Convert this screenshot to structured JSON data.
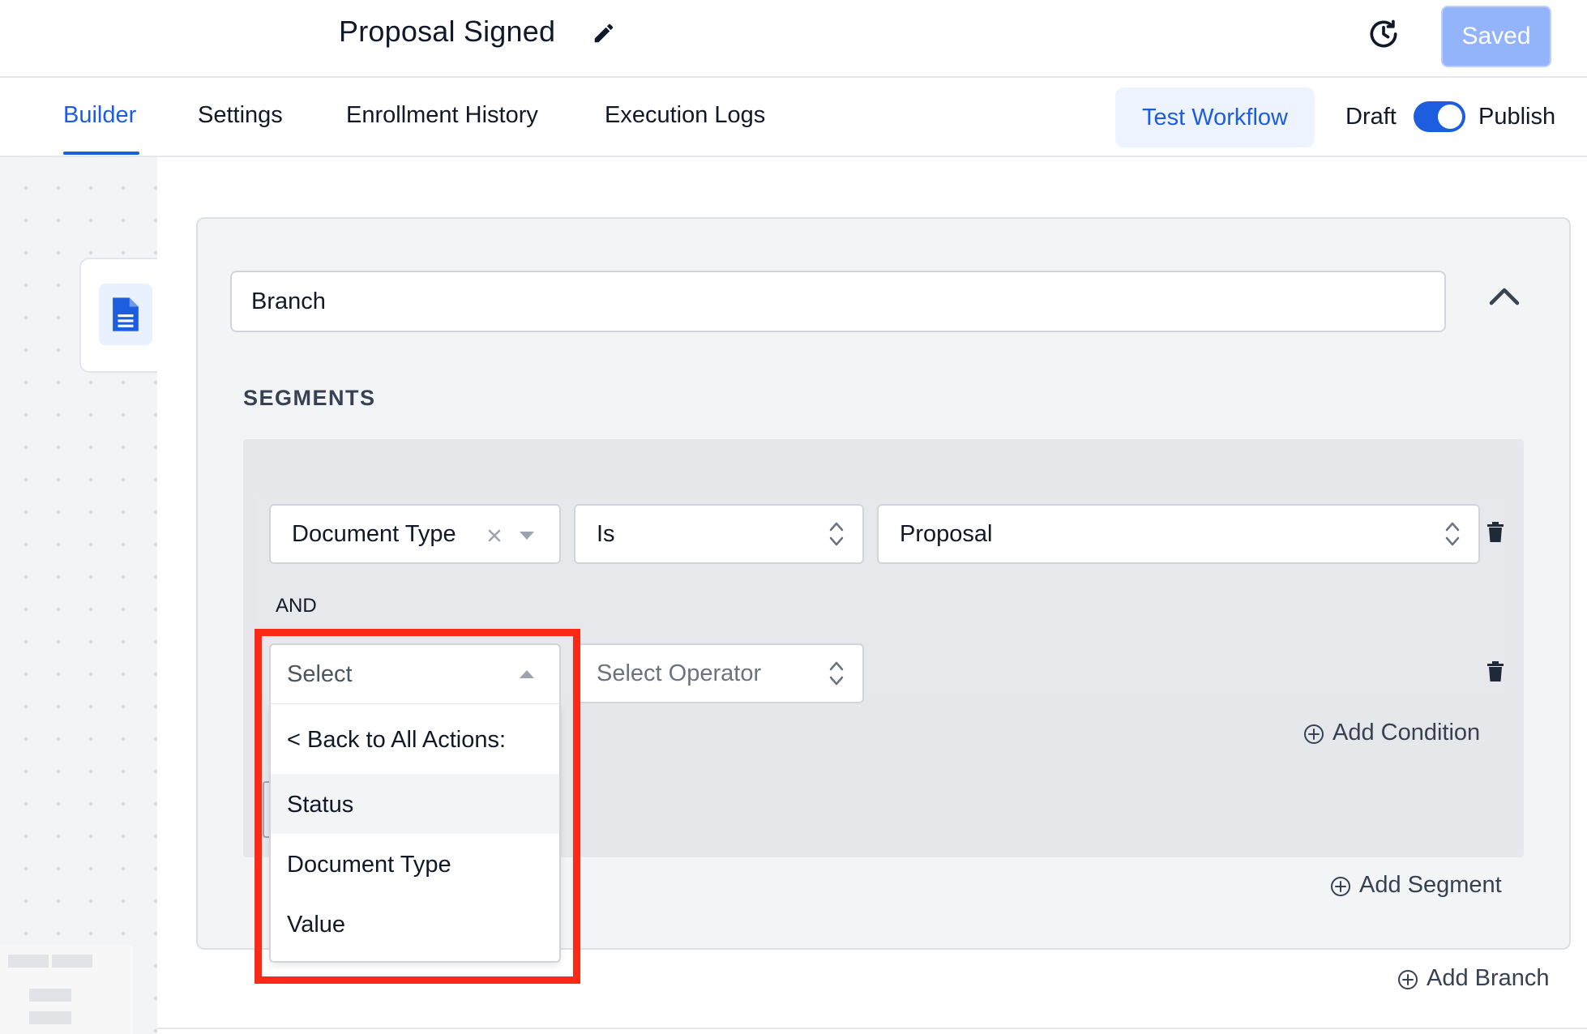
{
  "header": {
    "title": "Proposal Signed",
    "saved_label": "Saved"
  },
  "nav": {
    "tabs": [
      {
        "label": "Builder",
        "active": true
      },
      {
        "label": "Settings",
        "active": false
      },
      {
        "label": "Enrollment History",
        "active": false
      },
      {
        "label": "Execution Logs",
        "active": false
      }
    ],
    "test_workflow_label": "Test Workflow",
    "draft_label": "Draft",
    "publish_label": "Publish",
    "publish_toggle_on": true
  },
  "branch": {
    "name_value": "Branch",
    "segments_label": "SEGMENTS",
    "condition_1": {
      "field": "Document Type",
      "operator": "Is",
      "value": "Proposal"
    },
    "and_label": "AND",
    "condition_2": {
      "field_placeholder": "Select",
      "operator_placeholder": "Select Operator"
    },
    "add_condition_label": "Add Condition",
    "add_segment_label": "Add Segment",
    "add_branch_label": "Add Branch"
  },
  "dropdown": {
    "back_label": "< Back to All Actions:",
    "options": [
      "Status",
      "Document Type",
      "Value"
    ],
    "hovered_option": "Status"
  },
  "colors": {
    "accent": "#1d5ee0",
    "saved_button": "#93b4fa",
    "highlight": "#fb2a16"
  },
  "icons": {
    "edit": "pencil-icon",
    "history": "clock-history-icon",
    "node": "document-icon",
    "collapse": "chevron-up-icon",
    "delete": "trash-icon",
    "add": "plus-circle-icon"
  }
}
